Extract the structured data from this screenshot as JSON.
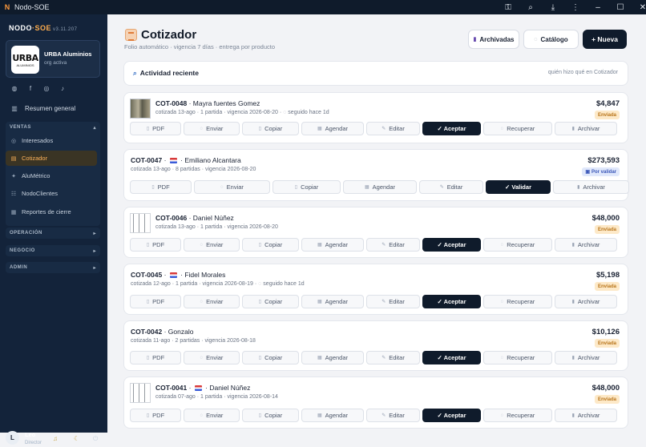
{
  "window": {
    "title": "Nodo-SOE",
    "logo": "N"
  },
  "sidebar": {
    "brand_a": "NODO",
    "brand_dot": "·",
    "brand_b": "SOE",
    "version": "v3.11.207",
    "org": {
      "logo_text": "URBA",
      "logo_sub": "ALUMINIOS",
      "name": "URBA Aluminios",
      "status": "org activa"
    },
    "summary": "Resumen general",
    "sections": {
      "ventas": "VENTAS",
      "operacion": "OPERACIÓN",
      "negocio": "NEGOCIO",
      "admin": "ADMIN"
    },
    "ventas_items": [
      {
        "label": "Interesados",
        "icon": "target-icon"
      },
      {
        "label": "Cotizador",
        "icon": "calculator-icon"
      },
      {
        "label": "AluMétrico",
        "icon": "sparkle-icon"
      },
      {
        "label": "NodoClientes",
        "icon": "people-icon"
      },
      {
        "label": "Reportes de cierre",
        "icon": "report-icon"
      }
    ],
    "user": {
      "initial": "L",
      "name": "Leo",
      "role": "Director"
    }
  },
  "header": {
    "title": "Cotizador",
    "subtitle": "Folio automático · vigencia 7 días · entrega por producto",
    "archived_label": "Archivadas",
    "catalog_label": "Catálogo",
    "new_label": "+ Nueva"
  },
  "activity": {
    "title": "Actividad reciente",
    "right": "quién hizo qué en Cotizador"
  },
  "actions": {
    "pdf": "PDF",
    "enviar": "Enviar",
    "copiar": "Copiar",
    "agendar": "Agendar",
    "editar": "Editar",
    "aceptar": "✓ Aceptar",
    "validar": "✓ Validar",
    "recuperar": "Recuperar",
    "archivar": "Archivar"
  },
  "quotes": [
    {
      "folio": "COT-0048",
      "client": "Mayra fuentes Gomez",
      "flag": false,
      "meta": "cotizada 13-ago · 1 partida · vigencia 2026-08-20 ·",
      "followup": "seguido hace 1d",
      "amount": "$4,847",
      "status": "Enviada"
    },
    {
      "folio": "COT-0047",
      "client": "Emiliano Alcantara",
      "flag": true,
      "meta": "cotizada 13-ago · 8 partidas · vigencia 2026-08-20",
      "followup": "",
      "amount": "$273,593",
      "status": "Por validar"
    },
    {
      "folio": "COT-0046",
      "client": "Daniel Núñez",
      "flag": false,
      "meta": "cotizada 13-ago · 1 partida · vigencia 2026-08-20",
      "followup": "",
      "amount": "$48,000",
      "status": "Enviada"
    },
    {
      "folio": "COT-0045",
      "client": "Fidel Morales",
      "flag": true,
      "meta": "cotizada 12-ago · 1 partida · vigencia 2026-08-19 ·",
      "followup": "seguido hace 1d",
      "amount": "$5,198",
      "status": "Enviada"
    },
    {
      "folio": "COT-0042",
      "client": "Gonzalo",
      "flag": false,
      "meta": "cotizada 11-ago · 2 partidas · vigencia 2026-08-18",
      "followup": "",
      "amount": "$10,126",
      "status": "Enviada"
    },
    {
      "folio": "COT-0041",
      "client": "Daniel Núñez",
      "flag": true,
      "meta": "cotizada 07-ago · 1 partida · vigencia 2026-08-14",
      "followup": "",
      "amount": "$48,000",
      "status": "Enviada"
    }
  ]
}
